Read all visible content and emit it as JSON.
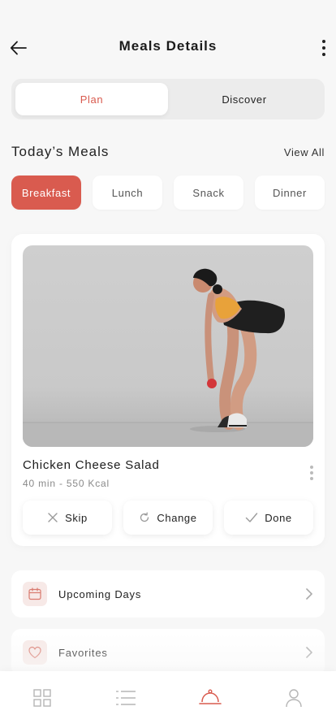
{
  "header": {
    "title": "Meals Details",
    "back_icon": "arrow-left-icon",
    "menu_icon": "more-vertical-icon"
  },
  "segment": {
    "tabs": [
      {
        "label": "Plan",
        "active": true
      },
      {
        "label": "Discover",
        "active": false
      }
    ]
  },
  "section": {
    "title": "Today’s Meals",
    "view_all": "View All"
  },
  "meal_types": [
    {
      "label": "Breakfast",
      "active": true
    },
    {
      "label": "Lunch",
      "active": false
    },
    {
      "label": "Snack",
      "active": false
    },
    {
      "label": "Dinner",
      "active": false
    }
  ],
  "meal_card": {
    "name": "Chicken Cheese Salad",
    "meta": "40 min - 550 Kcal",
    "actions": [
      {
        "label": "Skip",
        "icon": "close-icon"
      },
      {
        "label": "Change",
        "icon": "refresh-icon"
      },
      {
        "label": "Done",
        "icon": "check-icon"
      }
    ]
  },
  "links": [
    {
      "label": "Upcoming Days",
      "icon": "calendar-icon"
    },
    {
      "label": "Favorites",
      "icon": "heart-icon"
    }
  ],
  "tabbar": {
    "items": [
      "grid-icon",
      "list-icon",
      "meal-cloche-icon",
      "profile-icon"
    ],
    "active_index": 2
  },
  "colors": {
    "accent": "#d95b4f",
    "background": "#f7f7f7",
    "icon_tint_bg": "#f7e9e7"
  }
}
